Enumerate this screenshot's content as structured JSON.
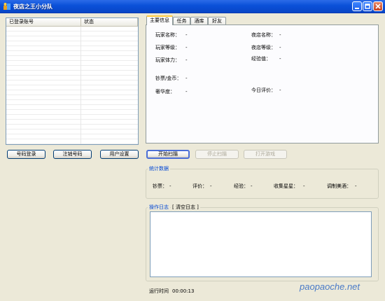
{
  "window": {
    "title": "夜店之王小分队"
  },
  "accounts_list": {
    "columns": [
      "已登录账号",
      "状态"
    ],
    "rows": []
  },
  "left_buttons": {
    "login": "号码登录",
    "logout": "注销号码",
    "settings": "用户设置"
  },
  "tabs": [
    "主要信息",
    "任务",
    "酒库",
    "好友"
  ],
  "main_info": {
    "player_name_label": "玩家名称：",
    "player_name_value": "-",
    "club_name_label": "夜店名称：",
    "club_name_value": "-",
    "player_level_label": "玩家等级：",
    "player_level_value": "-",
    "club_level_label": "夜店等级：",
    "club_level_value": "-",
    "stamina_label": "玩家体力：",
    "stamina_value": "-",
    "exp_label": "经验值：",
    "exp_value": "-",
    "money_label": "钞票/金币：",
    "money_value": "-",
    "luxury_label": "奢华度：",
    "luxury_value": "-",
    "today_rating_label": "今日评价：",
    "today_rating_value": "-"
  },
  "scan_buttons": {
    "start": "开始扫描",
    "stop": "停止扫描",
    "open_game": "打开游戏"
  },
  "stats": {
    "title": "统计数据",
    "money_label": "钞票：",
    "money_value": "-",
    "rating_label": "评价：",
    "rating_value": "-",
    "exp_label": "经验：",
    "exp_value": "-",
    "stars_label": "收集星星：",
    "stars_value": "-",
    "wine_label": "调制美酒：",
    "wine_value": "-"
  },
  "log": {
    "title": "操作日志",
    "clear": "[ 清空日志 ]"
  },
  "status": {
    "runtime_label": "运行时间",
    "runtime_value": "00:00:13"
  },
  "watermark": "paopaoche.net",
  "colors": {
    "titlebar": "#0a50d8",
    "window_bg": "#ece9d8",
    "group_title": "#0046d5",
    "active_tab_accent": "#ffc83c",
    "watermark": "#4a7bc8"
  }
}
